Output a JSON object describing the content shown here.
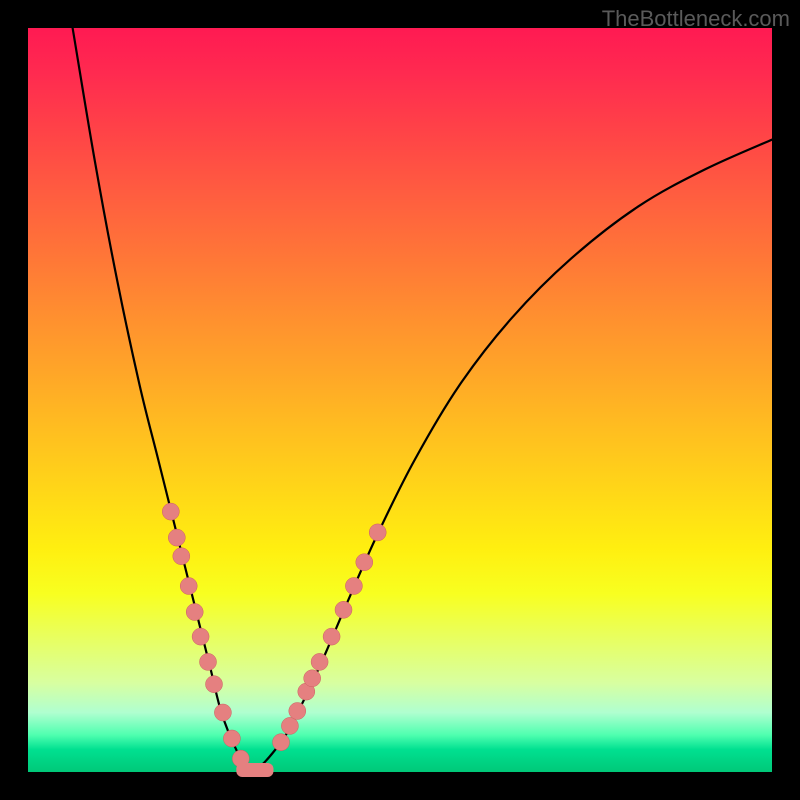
{
  "watermark": "TheBottleneck.com",
  "chart_data": {
    "type": "line",
    "title": "",
    "xlabel": "",
    "ylabel": "",
    "xlim": [
      0,
      1
    ],
    "ylim": [
      0,
      1
    ],
    "series": [
      {
        "name": "curve",
        "x": [
          0.06,
          0.09,
          0.12,
          0.15,
          0.175,
          0.2,
          0.215,
          0.23,
          0.245,
          0.26,
          0.28,
          0.3,
          0.34,
          0.37,
          0.4,
          0.43,
          0.47,
          0.52,
          0.58,
          0.65,
          0.73,
          0.82,
          0.91,
          1.0
        ],
        "y": [
          1.0,
          0.82,
          0.66,
          0.52,
          0.42,
          0.32,
          0.26,
          0.2,
          0.14,
          0.08,
          0.03,
          0.0,
          0.04,
          0.095,
          0.16,
          0.23,
          0.32,
          0.42,
          0.52,
          0.61,
          0.69,
          0.76,
          0.81,
          0.85
        ]
      }
    ],
    "markers": {
      "left": [
        {
          "x": 0.192,
          "y": 0.35
        },
        {
          "x": 0.2,
          "y": 0.315
        },
        {
          "x": 0.206,
          "y": 0.29
        },
        {
          "x": 0.216,
          "y": 0.25
        },
        {
          "x": 0.224,
          "y": 0.215
        },
        {
          "x": 0.232,
          "y": 0.182
        },
        {
          "x": 0.242,
          "y": 0.148
        },
        {
          "x": 0.25,
          "y": 0.118
        },
        {
          "x": 0.262,
          "y": 0.08
        },
        {
          "x": 0.274,
          "y": 0.045
        },
        {
          "x": 0.286,
          "y": 0.018
        }
      ],
      "right": [
        {
          "x": 0.34,
          "y": 0.04
        },
        {
          "x": 0.352,
          "y": 0.062
        },
        {
          "x": 0.362,
          "y": 0.082
        },
        {
          "x": 0.374,
          "y": 0.108
        },
        {
          "x": 0.382,
          "y": 0.126
        },
        {
          "x": 0.392,
          "y": 0.148
        },
        {
          "x": 0.408,
          "y": 0.182
        },
        {
          "x": 0.424,
          "y": 0.218
        },
        {
          "x": 0.438,
          "y": 0.25
        },
        {
          "x": 0.452,
          "y": 0.282
        },
        {
          "x": 0.47,
          "y": 0.322
        }
      ],
      "bottom_bar": {
        "x0": 0.28,
        "x1": 0.33,
        "y": 0.0
      }
    },
    "gradient_stops": [
      {
        "t": 0.0,
        "c": "#ff1a52"
      },
      {
        "t": 0.2,
        "c": "#ff6a3c"
      },
      {
        "t": 0.4,
        "c": "#ffb424"
      },
      {
        "t": 0.6,
        "c": "#ffe812"
      },
      {
        "t": 0.8,
        "c": "#e0ff60"
      },
      {
        "t": 0.92,
        "c": "#90ffc0"
      },
      {
        "t": 1.0,
        "c": "#00c878"
      }
    ]
  }
}
